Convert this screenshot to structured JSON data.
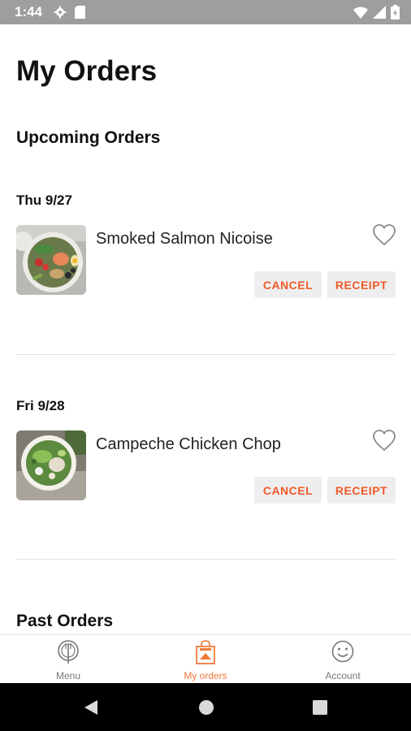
{
  "status_bar": {
    "time": "1:44",
    "icons": [
      "gear-icon",
      "sd-card-icon",
      "wifi-icon",
      "signal-icon",
      "battery-icon"
    ]
  },
  "page": {
    "title": "My Orders"
  },
  "sections": {
    "upcoming_title": "Upcoming Orders",
    "past_title": "Past Orders"
  },
  "orders": [
    {
      "date": "Thu 9/27",
      "name": "Smoked Salmon Nicoise",
      "cancel_label": "CANCEL",
      "receipt_label": "RECEIPT",
      "favorited": false
    },
    {
      "date": "Fri 9/28",
      "name": "Campeche Chicken Chop",
      "cancel_label": "CANCEL",
      "receipt_label": "RECEIPT",
      "favorited": false
    }
  ],
  "bottom_nav": {
    "items": [
      {
        "label": "Menu",
        "icon": "menu-icon",
        "active": false
      },
      {
        "label": "My orders",
        "icon": "shopping-bag-icon",
        "active": true
      },
      {
        "label": "Account",
        "icon": "smiley-icon",
        "active": false
      }
    ]
  },
  "colors": {
    "accent": "#f05a28",
    "nav_active": "#f07a38",
    "status_bar": "#9e9e9e",
    "button_bg": "#eeeeee"
  }
}
